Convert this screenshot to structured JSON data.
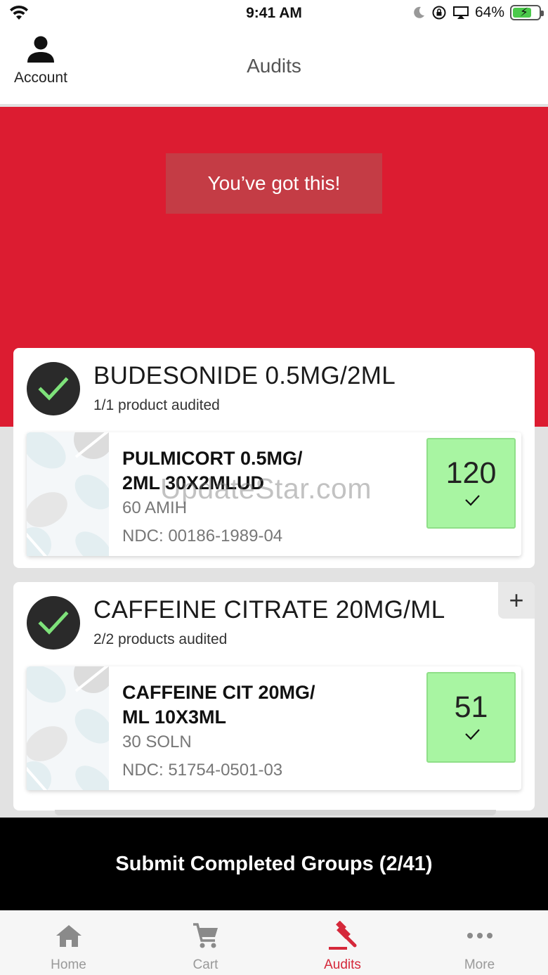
{
  "status_bar": {
    "time": "9:41 AM",
    "battery": "64%"
  },
  "header": {
    "account_label": "Account",
    "title": "Audits"
  },
  "hero": {
    "message": "You’ve got this!"
  },
  "groups": [
    {
      "title": "BUDESONIDE 0.5MG/2ML",
      "subtitle": "1/1 product audited",
      "product": {
        "name": "PULMICORT 0.5MG/ 2ML 30X2MLUD",
        "package": "60 AMIH",
        "ndc": "NDC: 00186-1989-04",
        "quantity": "120"
      }
    },
    {
      "title": "CAFFEINE CITRATE 20MG/ML",
      "subtitle": "2/2 products audited",
      "add_label": "+",
      "product": {
        "name": "CAFFEINE CIT 20MG/ ML 10X3ML",
        "package": "30 SOLN",
        "ndc": "NDC: 51754-0501-03",
        "quantity": "51"
      }
    }
  ],
  "watermark": "UpdateStar.com",
  "submit": {
    "label": "Submit Completed Groups (2/41)"
  },
  "tabs": [
    {
      "label": "Home",
      "icon": "home-icon"
    },
    {
      "label": "Cart",
      "icon": "cart-icon"
    },
    {
      "label": "Audits",
      "icon": "gavel-icon"
    },
    {
      "label": "More",
      "icon": "more-icon"
    }
  ],
  "colors": {
    "hero": "#dc1c31",
    "banner": "#c43c45",
    "quantity_ok": "#a8f5a2",
    "check_green": "#7ee27a",
    "tab_active": "#d5283a"
  }
}
